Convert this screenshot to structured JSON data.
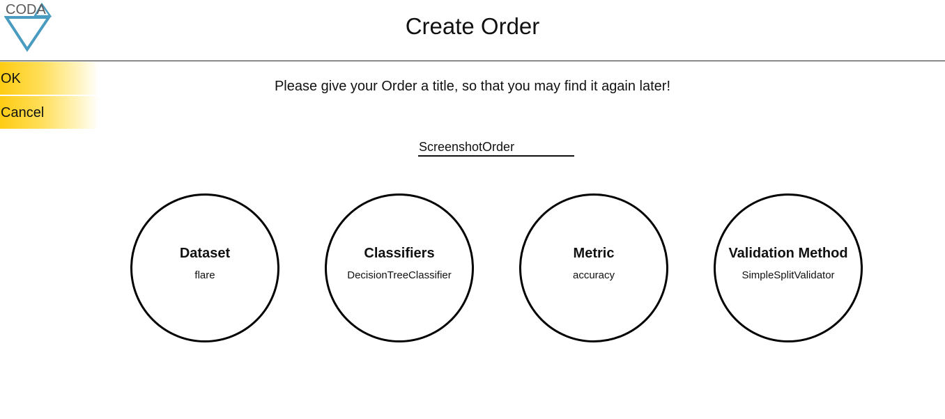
{
  "header": {
    "logo_text": "CODA",
    "title": "Create Order"
  },
  "sidebar": {
    "items": [
      {
        "label": "OK"
      },
      {
        "label": "Cancel"
      }
    ]
  },
  "main": {
    "prompt": "Please give your Order a title, so that you may find it again later!",
    "title_input": {
      "value": "ScreenshotOrder"
    },
    "options": [
      {
        "title": "Dataset",
        "value": "flare"
      },
      {
        "title": "Classifiers",
        "value": "DecisionTreeClassifier"
      },
      {
        "title": "Metric",
        "value": "accuracy"
      },
      {
        "title": "Validation Method",
        "value": "SimpleSplitValidator"
      }
    ]
  },
  "colors": {
    "accent_yellow": "#ffcc14",
    "logo_blue": "#4a9bc0",
    "logo_gray": "#5a5a5a"
  },
  "icons": {
    "logo": "coda-triangle-logo"
  }
}
